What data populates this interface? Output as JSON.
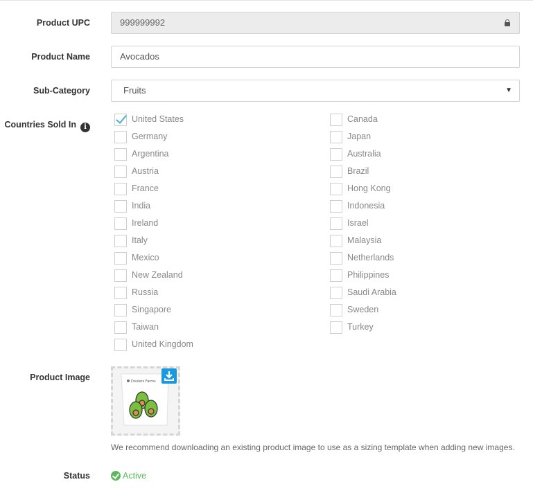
{
  "form": {
    "upc": {
      "label": "Product UPC",
      "value": "999999992"
    },
    "name": {
      "label": "Product Name",
      "value": "Avocados"
    },
    "subcategory": {
      "label": "Sub-Category",
      "value": "Fruits"
    },
    "countries": {
      "label": "Countries Sold In",
      "left": [
        {
          "name": "United States",
          "checked": true
        },
        {
          "name": "Germany",
          "checked": false
        },
        {
          "name": "Argentina",
          "checked": false
        },
        {
          "name": "Austria",
          "checked": false
        },
        {
          "name": "France",
          "checked": false
        },
        {
          "name": "India",
          "checked": false
        },
        {
          "name": "Ireland",
          "checked": false
        },
        {
          "name": "Italy",
          "checked": false
        },
        {
          "name": "Mexico",
          "checked": false
        },
        {
          "name": "New Zealand",
          "checked": false
        },
        {
          "name": "Russia",
          "checked": false
        },
        {
          "name": "Singapore",
          "checked": false
        },
        {
          "name": "Taiwan",
          "checked": false
        },
        {
          "name": "United Kingdom",
          "checked": false
        }
      ],
      "right": [
        {
          "name": "Canada",
          "checked": false
        },
        {
          "name": "Japan",
          "checked": false
        },
        {
          "name": "Australia",
          "checked": false
        },
        {
          "name": "Brazil",
          "checked": false
        },
        {
          "name": "Hong Kong",
          "checked": false
        },
        {
          "name": "Indonesia",
          "checked": false
        },
        {
          "name": "Israel",
          "checked": false
        },
        {
          "name": "Malaysia",
          "checked": false
        },
        {
          "name": "Netherlands",
          "checked": false
        },
        {
          "name": "Philippines",
          "checked": false
        },
        {
          "name": "Saudi Arabia",
          "checked": false
        },
        {
          "name": "Sweden",
          "checked": false
        },
        {
          "name": "Turkey",
          "checked": false
        }
      ]
    },
    "image": {
      "label": "Product Image",
      "package_text": "Doulers Farms",
      "note": "We recommend downloading an existing product image to use as a sizing template when adding new images."
    },
    "status": {
      "label": "Status",
      "value": "Active"
    }
  },
  "colors": {
    "accent": "#4bb1cf",
    "download": "#1a98e0",
    "active": "#5cb85c"
  }
}
